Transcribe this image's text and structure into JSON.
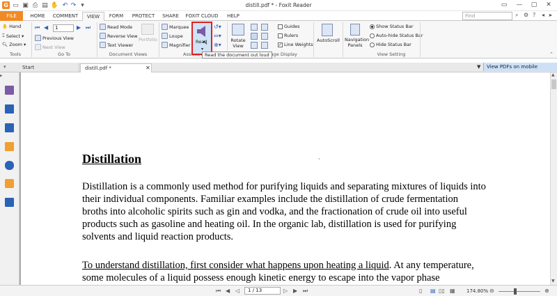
{
  "window": {
    "title": "distill.pdf * - Foxit Reader"
  },
  "tabs": [
    {
      "label": "FILE"
    },
    {
      "label": "HOME"
    },
    {
      "label": "COMMENT"
    },
    {
      "label": "VIEW"
    },
    {
      "label": "FORM"
    },
    {
      "label": "PROTECT"
    },
    {
      "label": "SHARE"
    },
    {
      "label": "FOXIT CLOUD"
    },
    {
      "label": "HELP"
    }
  ],
  "search": {
    "placeholder": "Find"
  },
  "ribbon": {
    "tools": {
      "hand": "Hand",
      "select": "Select",
      "zoom": "Zoom",
      "group": "Tools"
    },
    "goto": {
      "page": "1",
      "previous_view": "Previous View",
      "next_view": "Next View",
      "group": "Go To"
    },
    "docviews": {
      "read_mode": "Read Mode",
      "reverse_view": "Reverse View",
      "text_viewer": "Text Viewer",
      "portfolio": "Portfolio",
      "group": "Document Views"
    },
    "assistant": {
      "marquee": "Marquee",
      "loupe": "Loupe",
      "magnifier": "Magnifier",
      "read": "Read",
      "group": "Assistant"
    },
    "pagedisplay": {
      "rotate_view": "Rotate View",
      "guides": "Guides",
      "rulers": "Rulers",
      "line_weights": "Line Weights",
      "group": "Page Display"
    },
    "autoscroll": {
      "label": "AutoScroll"
    },
    "navigation": {
      "label": "Navigation Panels"
    },
    "viewsetting": {
      "show_status": "Show Status Bar",
      "auto_hide": "Auto-hide Status Bar",
      "hide_status": "Hide Status Bar",
      "group": "View Setting"
    },
    "tooltip": "Read the document out loud"
  },
  "doctabs": {
    "start": "Start",
    "file": "distill.pdf *",
    "mobile": "View PDFs on mobile devices"
  },
  "document": {
    "heading": "Distillation",
    "p1": [
      "Distillation is a commonly used method for purifying liquids and separating mixtures of liquids into",
      "their individual components.  Familiar examples include the distillation of crude fermentation",
      "broths into alcoholic spirits such as gin and vodka, and the fractionation of crude oil into useful",
      "products such as gasoline and heating oil. In the organic lab, distillation is used for purifying",
      "solvents and liquid reaction products."
    ],
    "p2_underlined": "To understand distillation, first consider what happens upon heating a liquid",
    "p2_rest": ".  At any temperature,",
    "p2_line2": "some molecules of a liquid possess enough kinetic energy to escape into the vapor phase"
  },
  "status": {
    "page": "1 / 13",
    "zoom": "174.80%"
  }
}
